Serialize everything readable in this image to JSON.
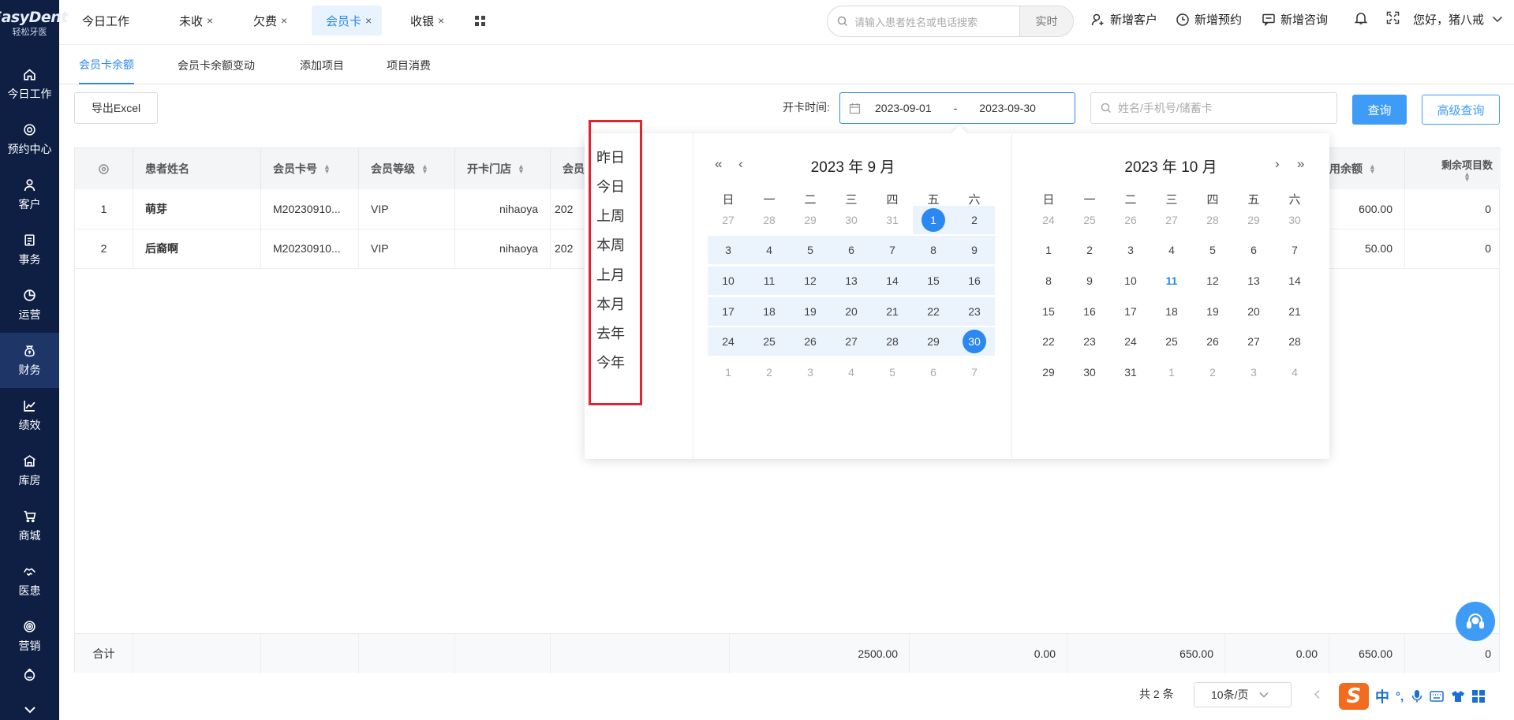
{
  "sidebar": {
    "logo_top": "EasyDent",
    "logo_sub": "轻松牙医",
    "items": [
      {
        "label": "今日工作",
        "icon": "home-icon"
      },
      {
        "label": "预约中心",
        "icon": "appointment-icon"
      },
      {
        "label": "客户",
        "icon": "user-icon"
      },
      {
        "label": "事务",
        "icon": "task-icon"
      },
      {
        "label": "运营",
        "icon": "pie-chart-icon"
      },
      {
        "label": "财务",
        "icon": "money-bag-icon"
      },
      {
        "label": "绩效",
        "icon": "trend-icon"
      },
      {
        "label": "库房",
        "icon": "warehouse-icon"
      },
      {
        "label": "商城",
        "icon": "cart-icon"
      },
      {
        "label": "医患",
        "icon": "handshake-icon"
      },
      {
        "label": "营销",
        "icon": "target-icon"
      }
    ],
    "active": "财务"
  },
  "topbar": {
    "tabs": [
      {
        "label": "今日工作",
        "closable": false
      },
      {
        "label": "未收",
        "closable": true
      },
      {
        "label": "欠费",
        "closable": true
      },
      {
        "label": "会员卡",
        "closable": true,
        "active": true
      },
      {
        "label": "收银",
        "closable": true
      }
    ],
    "close_glyph": "×",
    "search_placeholder": "请输入患者姓名或电话搜索",
    "search_mode": "实时",
    "actions": {
      "new_customer": "新增客户",
      "new_appointment": "新增预约",
      "new_consult": "新增咨询"
    },
    "greeting": "您好，猪八戒"
  },
  "subtabs": [
    "会员卡余额",
    "会员卡余额变动",
    "添加项目",
    "项目消费"
  ],
  "toolbar": {
    "export": "导出Excel",
    "date_label": "开卡时间:",
    "date_start": "2023-09-01",
    "date_sep": "-",
    "date_end": "2023-09-30",
    "search_placeholder": "姓名/手机号/储蓄卡",
    "query": "查询",
    "advanced": "高级查询"
  },
  "table": {
    "headers": {
      "name": "患者姓名",
      "card_no": "会员卡号",
      "level": "会员等级",
      "store": "开卡门店",
      "col5": "会员",
      "usable": "可用余额",
      "remaining": "剩余项目数"
    },
    "usable_visible": "用余额",
    "rows": [
      {
        "idx": "1",
        "name": "萌芽",
        "card_no": "M20230910...",
        "level": "VIP",
        "store": "nihaoya",
        "date_prefix": "202",
        "usable": "600.00",
        "remaining": "0"
      },
      {
        "idx": "2",
        "name": "后裔啊",
        "card_no": "M20230910...",
        "level": "VIP",
        "store": "nihaoya",
        "date_prefix": "202",
        "usable": "50.00",
        "remaining": "0"
      }
    ],
    "totals": {
      "label": "合计",
      "v1": "2500.00",
      "v2": "0.00",
      "v3": "650.00",
      "v4": "0.00",
      "v5": "650.00",
      "v6": "0"
    }
  },
  "pagination": {
    "total": "共 2 条",
    "per_page": "10条/页"
  },
  "datepicker": {
    "shortcuts": [
      "昨日",
      "今日",
      "上周",
      "本周",
      "上月",
      "本月",
      "去年",
      "今年"
    ],
    "weekdays": [
      "日",
      "一",
      "二",
      "三",
      "四",
      "五",
      "六"
    ],
    "left_title": "2023 年 9 月",
    "right_title": "2023 年 10 月",
    "left_days": [
      [
        "27",
        "28",
        "29",
        "30",
        "31",
        "1",
        "2"
      ],
      [
        "3",
        "4",
        "5",
        "6",
        "7",
        "8",
        "9"
      ],
      [
        "10",
        "11",
        "12",
        "13",
        "14",
        "15",
        "16"
      ],
      [
        "17",
        "18",
        "19",
        "20",
        "21",
        "22",
        "23"
      ],
      [
        "24",
        "25",
        "26",
        "27",
        "28",
        "29",
        "30"
      ],
      [
        "1",
        "2",
        "3",
        "4",
        "5",
        "6",
        "7"
      ]
    ],
    "right_days": [
      [
        "24",
        "25",
        "26",
        "27",
        "28",
        "29",
        "30"
      ],
      [
        "1",
        "2",
        "3",
        "4",
        "5",
        "6",
        "7"
      ],
      [
        "8",
        "9",
        "10",
        "11",
        "12",
        "13",
        "14"
      ],
      [
        "15",
        "16",
        "17",
        "18",
        "19",
        "20",
        "21"
      ],
      [
        "22",
        "23",
        "24",
        "25",
        "26",
        "27",
        "28"
      ],
      [
        "29",
        "30",
        "31",
        "1",
        "2",
        "3",
        "4"
      ]
    ],
    "today": "11",
    "nav": {
      "prev_year": "«",
      "prev_month": "‹",
      "next_month": "›",
      "next_year": "»"
    }
  },
  "ime": {
    "mode": "中",
    "punct": "°,"
  },
  "colors": {
    "accent": "#2b88f0",
    "sidebar": "#0e1f43",
    "highlight": "#e3232d"
  }
}
